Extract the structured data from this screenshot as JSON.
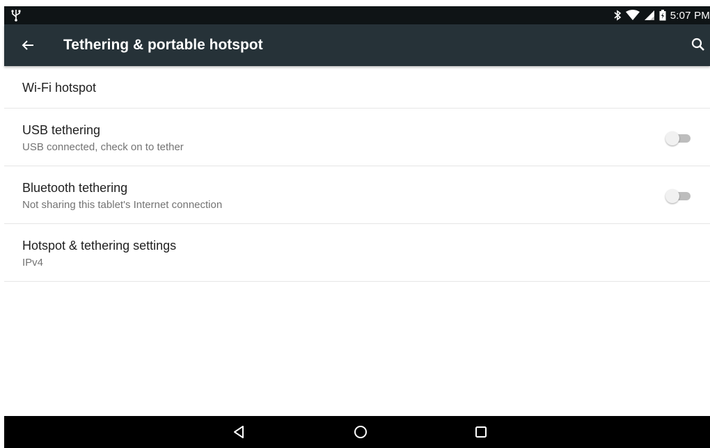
{
  "status_bar": {
    "time": "5:07 PM",
    "icons": [
      "usb-icon",
      "bluetooth-icon",
      "wifi-icon",
      "cellular-signal-icon",
      "battery-icon"
    ]
  },
  "app_bar": {
    "title": "Tethering & portable hotspot",
    "back_icon": "arrow-back-icon",
    "search_icon": "search-icon",
    "color": "#263238"
  },
  "items": [
    {
      "title": "Wi-Fi hotspot"
    },
    {
      "title": "USB tethering",
      "subtitle": "USB connected, check on to tether",
      "toggle": false
    },
    {
      "title": "Bluetooth tethering",
      "subtitle": "Not sharing this tablet's Internet connection",
      "toggle": false
    },
    {
      "title": "Hotspot & tethering settings",
      "subtitle": "IPv4"
    }
  ],
  "nav_bar": {
    "buttons": [
      "back-triangle-icon",
      "home-circle-icon",
      "recents-square-icon"
    ]
  }
}
